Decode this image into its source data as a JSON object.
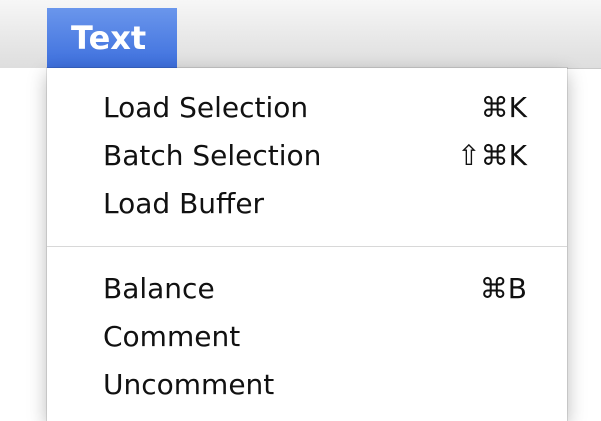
{
  "menu_bar": {
    "active_menu": "Text"
  },
  "menu": {
    "items": [
      {
        "label": "Load Selection",
        "shortcut": "⌘K"
      },
      {
        "label": "Batch Selection",
        "shortcut": "⇧⌘K"
      },
      {
        "label": "Load Buffer",
        "shortcut": ""
      },
      {
        "label": "Balance",
        "shortcut": "⌘B"
      },
      {
        "label": "Comment",
        "shortcut": ""
      },
      {
        "label": "Uncomment",
        "shortcut": ""
      }
    ]
  },
  "colors": {
    "menu_highlight": "#3d6fdd",
    "menu_text": "#111111",
    "menubar_bg": "#e7e7e7"
  }
}
